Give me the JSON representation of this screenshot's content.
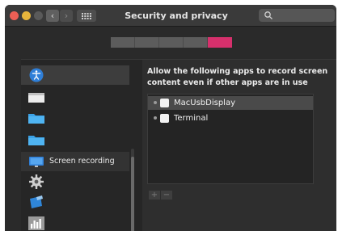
{
  "window": {
    "title": "Security and privacy",
    "nav": {
      "back": "‹",
      "forward": "›"
    }
  },
  "search": {
    "placeholder": ""
  },
  "tabs": {
    "count": 5,
    "active_index": 4,
    "active_color": "#d6306c"
  },
  "sidebar": {
    "items": [
      {
        "icon": "accessibility-icon",
        "label": ""
      },
      {
        "icon": "blank-document-icon",
        "label": ""
      },
      {
        "icon": "folder-icon",
        "label": ""
      },
      {
        "icon": "folder-icon",
        "label": ""
      },
      {
        "icon": "display-icon",
        "label": "Screen recording"
      },
      {
        "icon": "gear-icon",
        "label": ""
      },
      {
        "icon": "xcode-tools-icon",
        "label": ""
      },
      {
        "icon": "activity-chart-icon",
        "label": ""
      }
    ]
  },
  "main": {
    "description": "Allow the following apps to record screen content even if other apps are in use",
    "apps": [
      {
        "name": "MacUsbDisplay",
        "selected": true
      },
      {
        "name": "Terminal",
        "selected": false
      }
    ],
    "add_label": "+",
    "remove_label": "−"
  }
}
